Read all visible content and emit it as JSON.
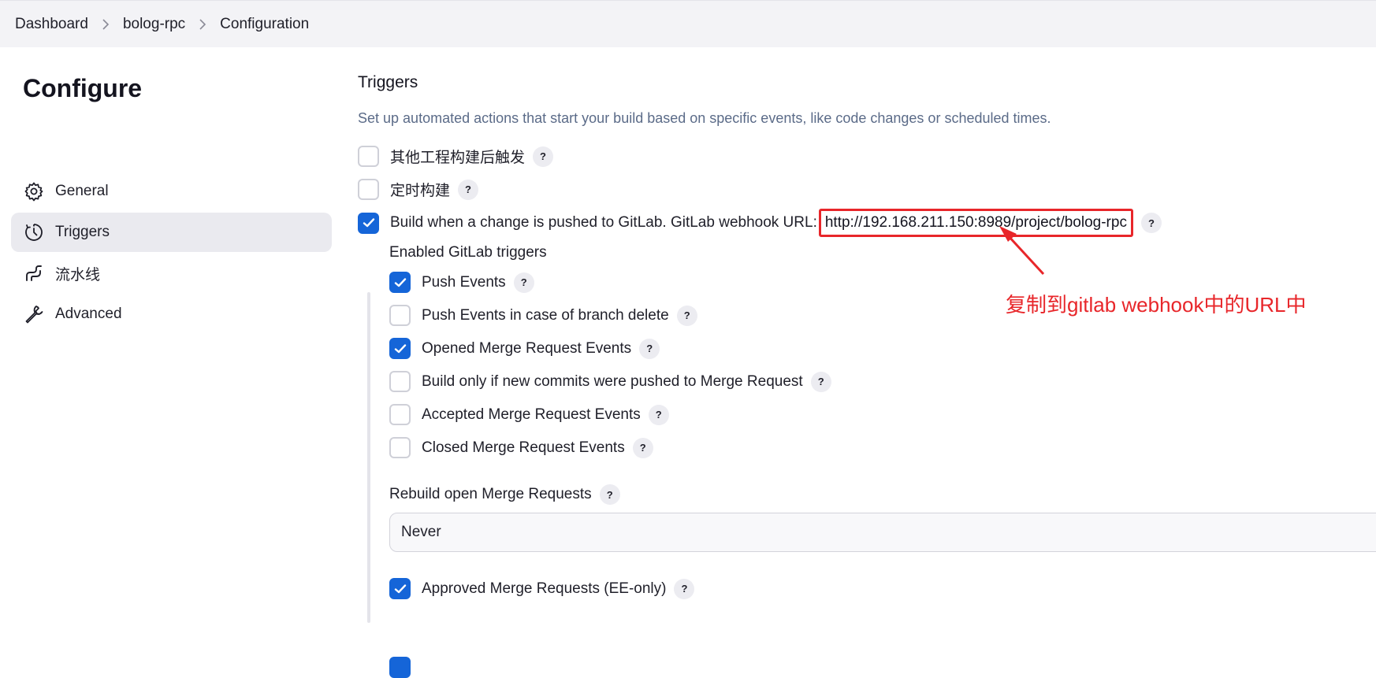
{
  "breadcrumb": {
    "items": [
      "Dashboard",
      "bolog-rpc",
      "Configuration"
    ]
  },
  "sidebar": {
    "title": "Configure",
    "items": [
      {
        "label": "General",
        "icon": "gear-icon"
      },
      {
        "label": "Triggers",
        "icon": "clock-icon",
        "active": true
      },
      {
        "label": "流水线",
        "icon": "pipeline-icon"
      },
      {
        "label": "Advanced",
        "icon": "wrench-icon"
      }
    ]
  },
  "triggers": {
    "title": "Triggers",
    "description": "Set up automated actions that start your build based on specific events, like code changes or scheduled times.",
    "options": [
      {
        "label": "其他工程构建后触发",
        "checked": false
      },
      {
        "label": "定时构建",
        "checked": false
      },
      {
        "label": "Build when a change is pushed to GitLab. GitLab webhook URL:",
        "checked": true
      }
    ],
    "webhook_url": "http://192.168.211.150:8989/project/bolog-rpc",
    "help_symbol": "?"
  },
  "gitlab": {
    "heading": "Enabled GitLab triggers",
    "events": [
      {
        "label": "Push Events",
        "checked": true
      },
      {
        "label": "Push Events in case of branch delete",
        "checked": false
      },
      {
        "label": "Opened Merge Request Events",
        "checked": true
      },
      {
        "label": "Build only if new commits were pushed to Merge Request",
        "checked": false
      },
      {
        "label": "Accepted Merge Request Events",
        "checked": false
      },
      {
        "label": "Closed Merge Request Events",
        "checked": false
      }
    ],
    "rebuild_label": "Rebuild open Merge Requests",
    "rebuild_value": "Never",
    "approved_label": "Approved Merge Requests (EE-only)",
    "approved_checked": true
  },
  "annotation": {
    "text": "复制到gitlab webhook中的URL中",
    "color": "#e8262a"
  },
  "colors": {
    "accent": "#1565d8",
    "annotation_red": "#e8262a"
  }
}
